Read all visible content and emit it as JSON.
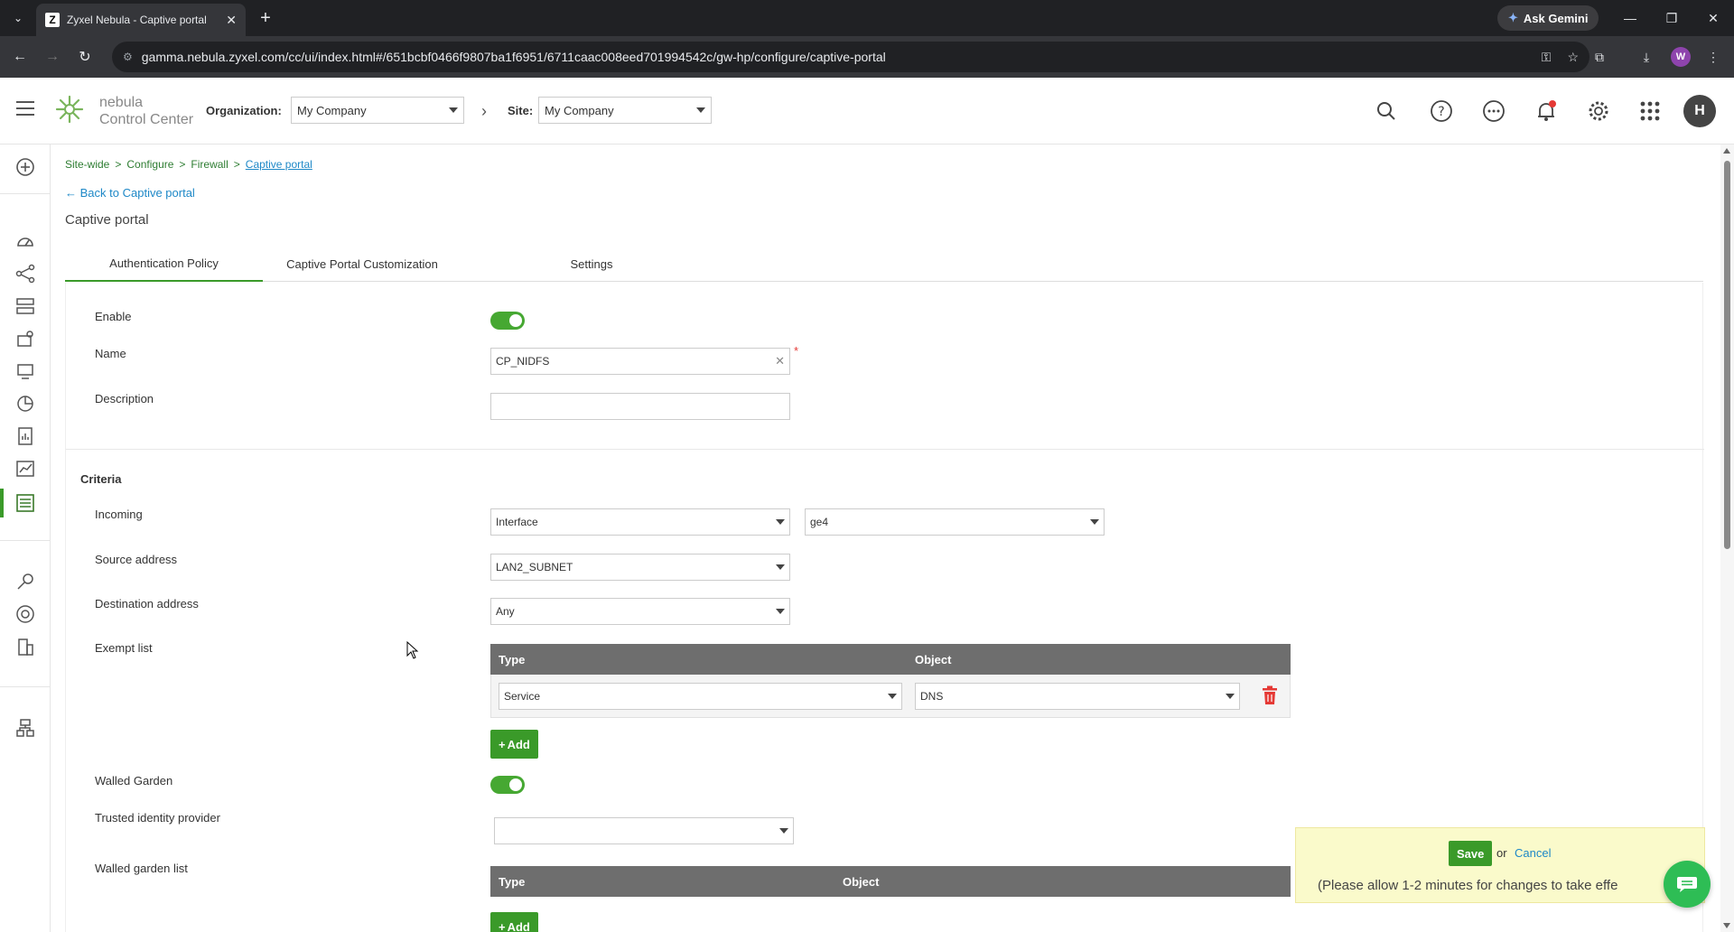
{
  "browser": {
    "tab_title": "Zyxel Nebula - Captive portal",
    "favicon_letter": "Z",
    "gemini_label": "Ask Gemini",
    "url": "gamma.nebula.zyxel.com/cc/ui/index.html#/651bcbf0466f9807ba1f6951/6711caac008eed701994542c/gw-hp/configure/captive-portal",
    "profile_letter": "W"
  },
  "header": {
    "brand_line1": "nebula",
    "brand_line2": "Control Center",
    "org_label": "Organization:",
    "org_value": "My Company",
    "site_label": "Site:",
    "site_value": "My Company",
    "avatar_letter": "H"
  },
  "breadcrumb": {
    "items": [
      "Site-wide",
      "Configure",
      "Firewall"
    ],
    "current": "Captive portal",
    "separator": ">"
  },
  "back_link": {
    "prefix": "Back to",
    "target": "Captive portal"
  },
  "page_title": "Captive portal",
  "tabs": [
    {
      "label": "Authentication Policy",
      "active": true
    },
    {
      "label": "Captive Portal Customization",
      "active": false
    },
    {
      "label": "Settings",
      "active": false
    }
  ],
  "form": {
    "enable_label": "Enable",
    "enable_on": true,
    "name_label": "Name",
    "name_value": "CP_NIDFS",
    "required_mark": "*",
    "description_label": "Description",
    "description_value": "",
    "criteria_title": "Criteria",
    "incoming_label": "Incoming",
    "incoming_type": "Interface",
    "incoming_value": "ge4",
    "source_label": "Source address",
    "source_value": "LAN2_SUBNET",
    "destination_label": "Destination address",
    "destination_value": "Any",
    "exempt_label": "Exempt list",
    "exempt_table": {
      "columns": [
        "Type",
        "Object"
      ],
      "rows": [
        {
          "type": "Service",
          "object": "DNS"
        }
      ]
    },
    "add_label": "Add",
    "walled_garden_label": "Walled Garden",
    "walled_garden_on": true,
    "trusted_idp_label": "Trusted identity provider",
    "trusted_idp_value": "",
    "walled_list_label": "Walled garden list",
    "walled_table": {
      "columns": [
        "Type",
        "Object"
      ]
    }
  },
  "save_bar": {
    "save_label": "Save",
    "or_text": "or",
    "cancel_label": "Cancel",
    "note": "(Please allow 1-2 minutes for changes to take effe"
  },
  "colors": {
    "accent_green": "#3a9a29",
    "link_blue": "#1e88c7",
    "table_header": "#6e6e6e",
    "save_bar_bg": "#fafacb",
    "delete_red": "#e53935"
  }
}
